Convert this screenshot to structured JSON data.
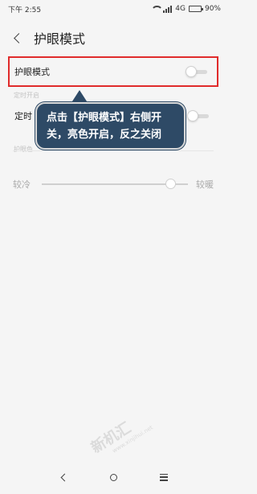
{
  "status_bar": {
    "time": "下午 2:55",
    "network": "4G",
    "battery_level": "90%",
    "battery_fraction": 0.9
  },
  "header": {
    "title": "护眼模式"
  },
  "eye_mode": {
    "label": "护眼模式",
    "enabled": false
  },
  "timer": {
    "label_visible": "定时",
    "sub_above": "定时开启"
  },
  "color_temp": {
    "section_label": "护眼色",
    "cold_label": "较冷",
    "warm_label": "较暖",
    "level": 0.88
  },
  "callout": {
    "text": "点击【护眼模式】右侧开关，亮色开启，反之关闭"
  },
  "watermark": {
    "logo": "新机汇",
    "url": "www.xinjihui.net"
  },
  "colors": {
    "highlight_border": "#e02b2b",
    "callout_bg": "#2e4a66"
  }
}
